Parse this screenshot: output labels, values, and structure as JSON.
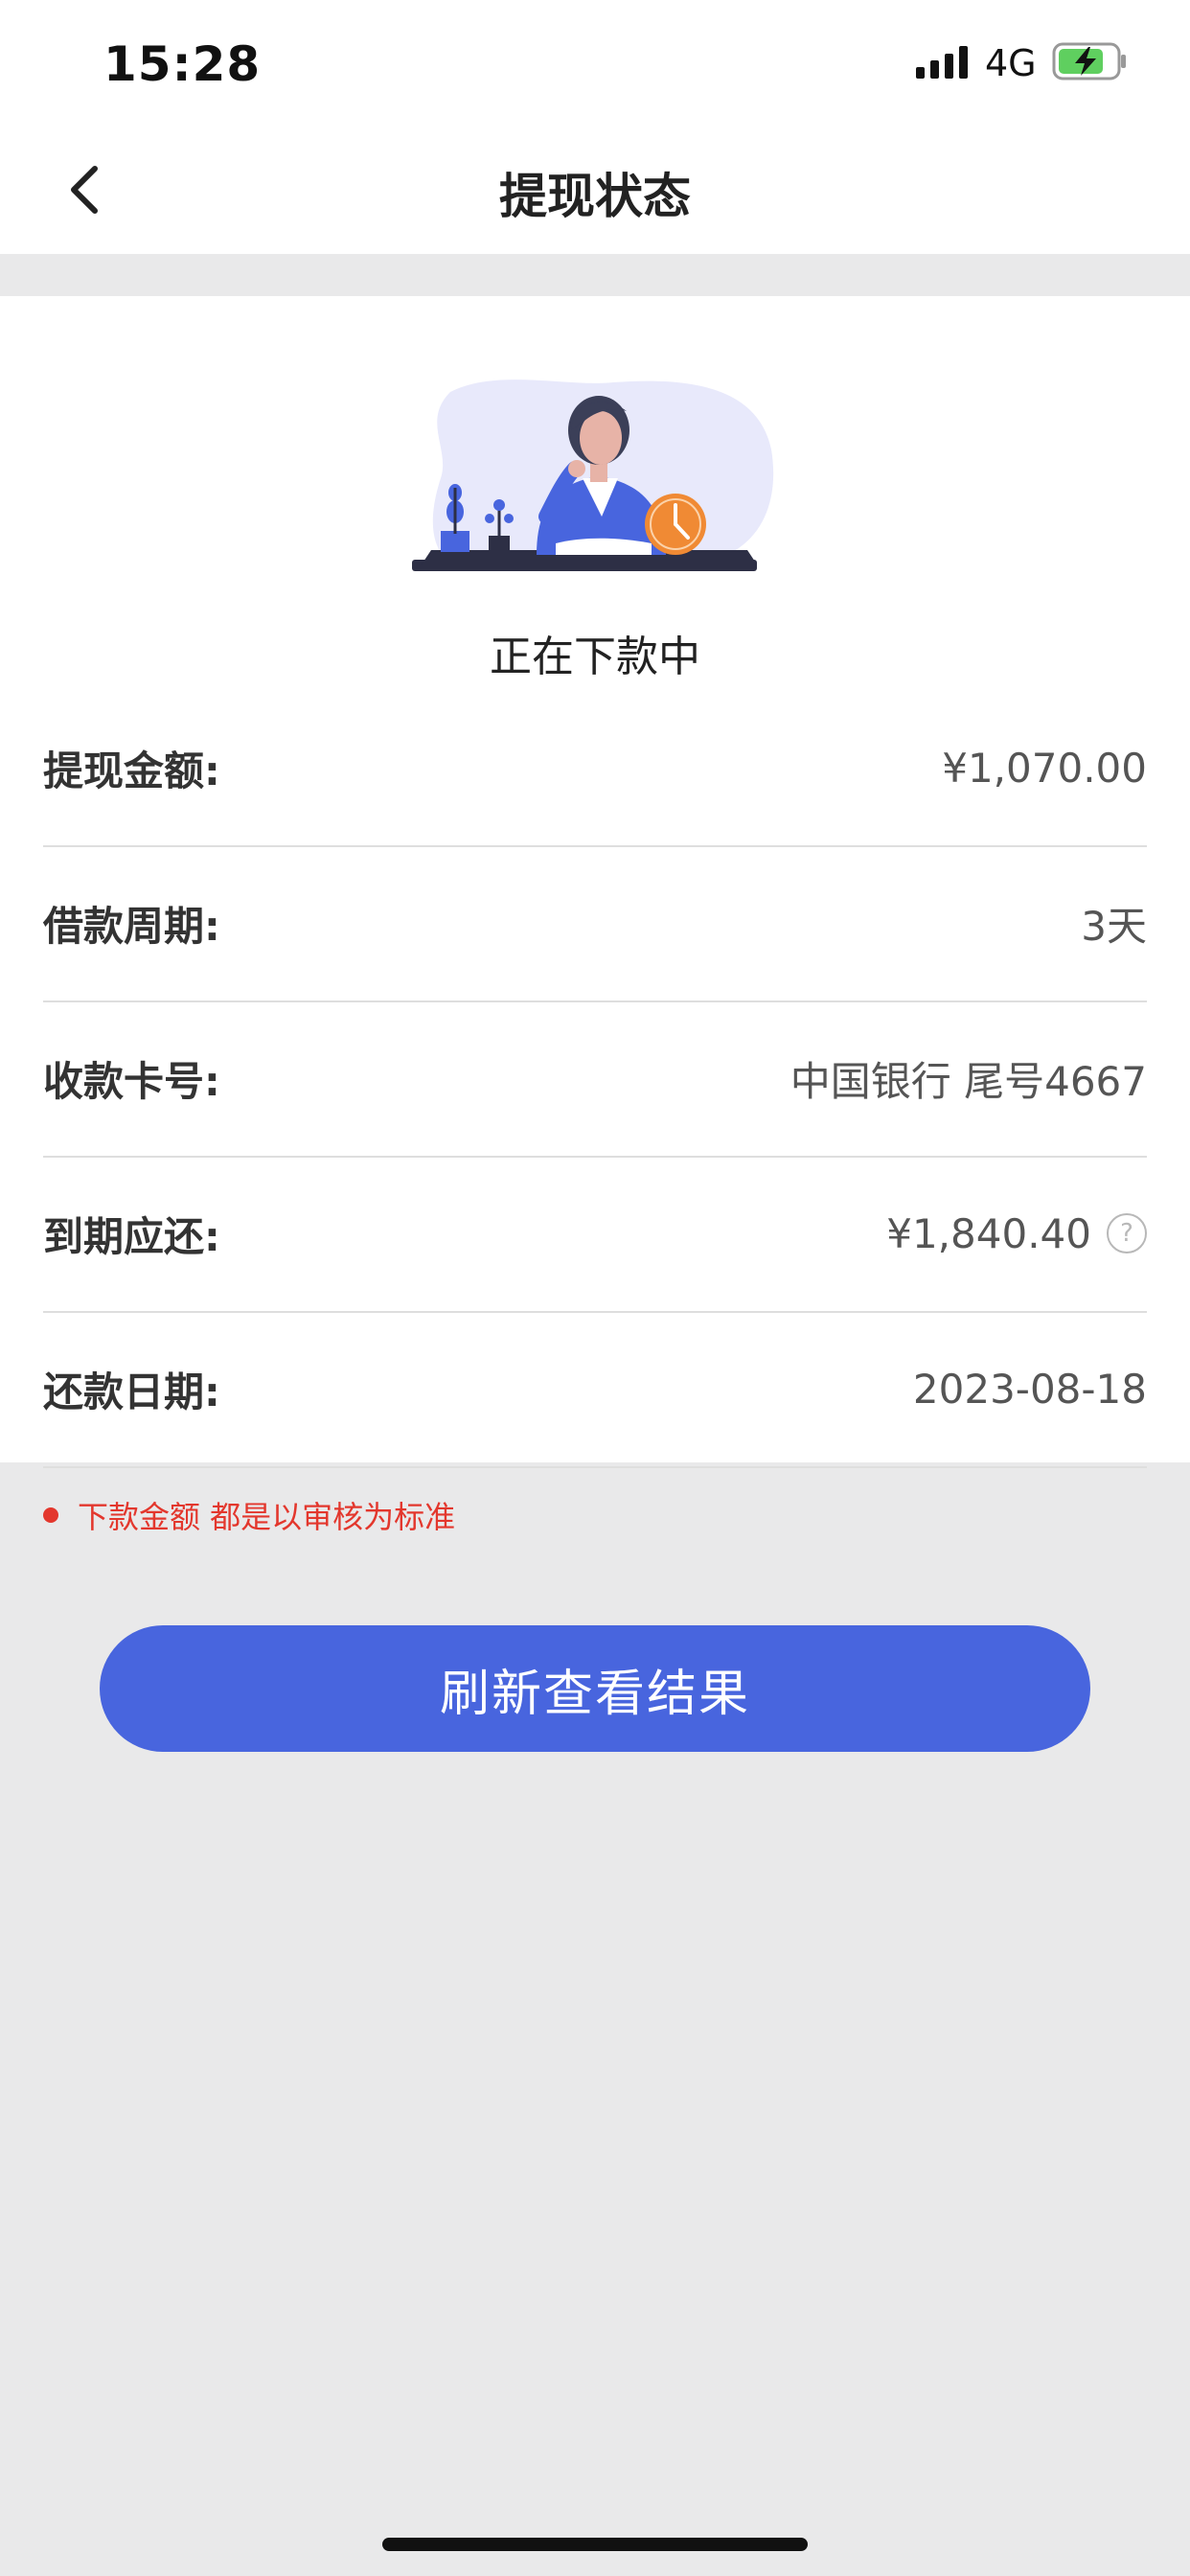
{
  "status_bar": {
    "time": "15:28",
    "network": "4G",
    "battery_icon": "battery-charging-icon",
    "signal_icon": "signal-bars-icon"
  },
  "nav": {
    "title": "提现状态",
    "back_icon": "chevron-left-icon"
  },
  "status": {
    "text": "正在下款中",
    "illustration": "woman-at-desk-with-clock"
  },
  "rows": [
    {
      "label": "提现金额:",
      "value": "¥1,070.00"
    },
    {
      "label": "借款周期:",
      "value": "3天"
    },
    {
      "label": "收款卡号:",
      "value": "中国银行 尾号4667"
    },
    {
      "label": "到期应还:",
      "value": "¥1,840.40",
      "help": "?"
    },
    {
      "label": "还款日期:",
      "value": "2023-08-18"
    }
  ],
  "notice": {
    "text": "下款金额 都是以审核为标准"
  },
  "refresh_button": {
    "label": "刷新查看结果"
  },
  "colors": {
    "accent": "#4865de",
    "notice": "#e3372d",
    "clock": "#f08a34",
    "background": "#e9e9ea"
  }
}
